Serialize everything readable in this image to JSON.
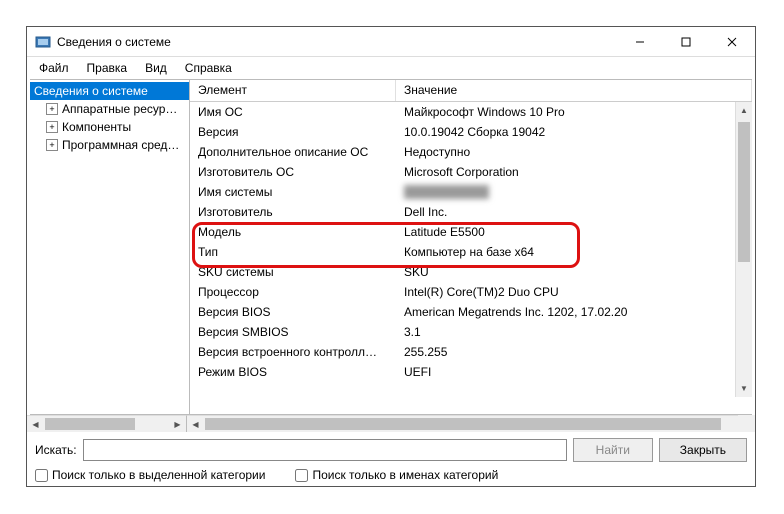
{
  "window": {
    "title": "Сведения о системе"
  },
  "menu": {
    "file": "Файл",
    "edit": "Правка",
    "view": "Вид",
    "help": "Справка"
  },
  "tree": {
    "root": "Сведения о системе",
    "hw": "Аппаратные ресур…",
    "comp": "Компоненты",
    "sw": "Программная сред…"
  },
  "table": {
    "head_element": "Элемент",
    "head_value": "Значение",
    "rows": [
      {
        "k": "Имя ОС",
        "v": "Майкрософт Windows 10 Pro"
      },
      {
        "k": "Версия",
        "v": "10.0.19042 Сборка 19042"
      },
      {
        "k": "Дополнительное описание ОС",
        "v": "Недоступно"
      },
      {
        "k": "Изготовитель ОС",
        "v": "Microsoft Corporation"
      },
      {
        "k": "Имя системы",
        "v": "blurred"
      },
      {
        "k": "Изготовитель",
        "v": "Dell Inc."
      },
      {
        "k": "Модель",
        "v": "Latitude E5500"
      },
      {
        "k": "Тип",
        "v": "Компьютер на базе x64"
      },
      {
        "k": "SKU системы",
        "v": "SKU"
      },
      {
        "k": "Процессор",
        "v": "Intel(R) Core(TM)2 Duo CPU"
      },
      {
        "k": "Версия BIOS",
        "v": "American Megatrends Inc. 1202, 17.02.20"
      },
      {
        "k": "Версия SMBIOS",
        "v": "3.1"
      },
      {
        "k": "Версия встроенного контролл…",
        "v": "255.255"
      },
      {
        "k": "Режим BIOS",
        "v": "UEFI"
      }
    ]
  },
  "bottom": {
    "search_label": "Искать:",
    "search_value": "",
    "find_btn": "Найти",
    "close_btn": "Закрыть",
    "check_selected": "Поиск только в выделенной категории",
    "check_names": "Поиск только в именах категорий"
  }
}
